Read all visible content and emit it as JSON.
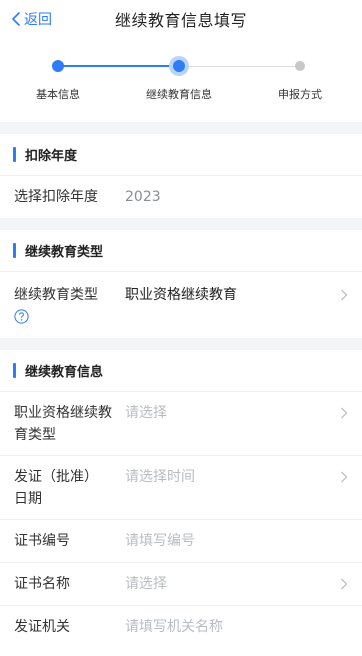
{
  "header": {
    "back_label": "返回",
    "title": "继续教育信息填写"
  },
  "stepper": {
    "steps": [
      {
        "label": "基本信息",
        "state": "done"
      },
      {
        "label": "继续教育信息",
        "state": "current"
      },
      {
        "label": "申报方式",
        "state": "todo"
      }
    ]
  },
  "deduction_year": {
    "title": "扣除年度",
    "row_label": "选择扣除年度",
    "row_value": "2023"
  },
  "education_type": {
    "title": "继续教育类型",
    "row_label": "继续教育类型",
    "row_value": "职业资格继续教育"
  },
  "education_info": {
    "title": "继续教育信息",
    "rows": [
      {
        "label": "职业资格继续教育类型",
        "placeholder": "请选择"
      },
      {
        "label": "发证（批准）日期",
        "placeholder": "请选择时间"
      },
      {
        "label": "证书编号",
        "placeholder": "请填写编号"
      },
      {
        "label": "证书名称",
        "placeholder": "请选择"
      },
      {
        "label": "发证机关",
        "placeholder": "请填写机关名称"
      }
    ]
  },
  "colors": {
    "accent": "#2f7cf6",
    "background": "#f4f5f7",
    "placeholder": "#b9bcc2",
    "inactive_step": "#c8c8c8"
  },
  "icons": {
    "back": "chevron-left-icon",
    "row_arrow": "chevron-right-icon",
    "help": "question-circle-icon"
  }
}
